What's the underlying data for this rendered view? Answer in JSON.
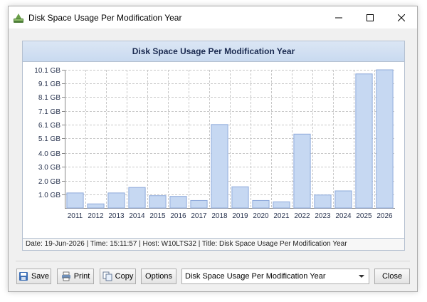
{
  "window": {
    "title": "Disk Space Usage Per Modification Year"
  },
  "chart_data": {
    "type": "bar",
    "title": "Disk Space Usage Per Modification Year",
    "categories": [
      "2011",
      "2012",
      "2013",
      "2014",
      "2015",
      "2016",
      "2017",
      "2018",
      "2019",
      "2020",
      "2021",
      "2022",
      "2023",
      "2024",
      "2025",
      "2026"
    ],
    "values": [
      1.1,
      0.3,
      1.1,
      1.5,
      0.9,
      0.85,
      0.55,
      6.1,
      1.55,
      0.55,
      0.45,
      5.4,
      0.95,
      1.25,
      9.8,
      10.1
    ],
    "unit": "GB",
    "yticks": [
      "1.0 GB",
      "2.0 GB",
      "3.0 GB",
      "4.0 GB",
      "5.1 GB",
      "6.1 GB",
      "7.1 GB",
      "8.1 GB",
      "9.1 GB",
      "10.1 GB"
    ],
    "ytick_values": [
      1.0,
      2.0,
      3.0,
      4.0,
      5.1,
      6.1,
      7.1,
      8.1,
      9.1,
      10.1
    ],
    "ylim": [
      0,
      10.1
    ],
    "grid": true,
    "bar_color": "#c6d8f2",
    "bar_border": "#8eaadb"
  },
  "status": {
    "text": "Date: 19-Jun-2026 | Time: 15:11:57 | Host: W10LTS32 | Title: Disk Space Usage Per Modification Year"
  },
  "toolbar": {
    "save_label": "Save",
    "print_label": "Print",
    "copy_label": "Copy",
    "options_label": "Options",
    "chart_select_value": "Disk Space Usage Per Modification Year",
    "close_label": "Close"
  }
}
